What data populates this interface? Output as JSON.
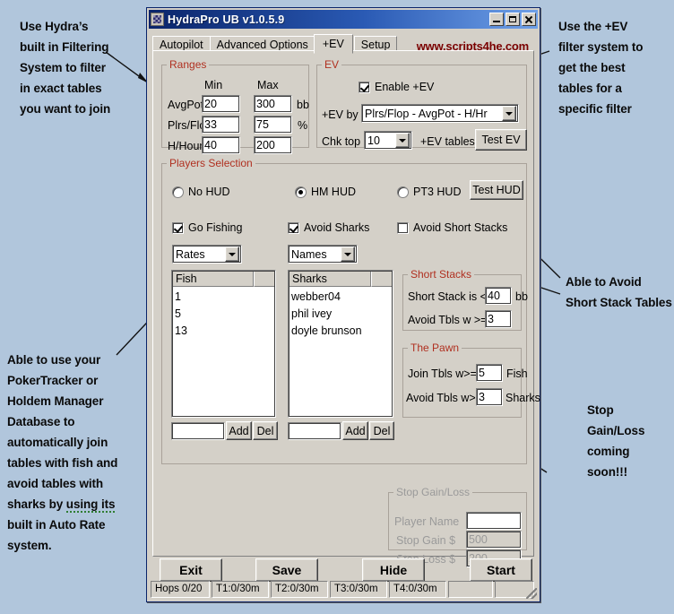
{
  "window": {
    "title": "HydraPro UB v1.0.5.9",
    "icon": "app-icon",
    "minimize": "_",
    "maximize": "□",
    "close": "×"
  },
  "tabs": [
    {
      "label": "Autopilot",
      "selected": false
    },
    {
      "label": "Advanced Options",
      "selected": false
    },
    {
      "label": "+EV",
      "selected": true
    },
    {
      "label": "Setup",
      "selected": false
    }
  ],
  "brand": "www.scripts4he.com",
  "ranges": {
    "legend": "Ranges",
    "col_min": "Min",
    "col_max": "Max",
    "rows": [
      {
        "label": "AvgPot",
        "min": "20",
        "max": "300",
        "unit": "bb"
      },
      {
        "label": "Plrs/Flop",
        "min": "33",
        "max": "75",
        "unit": "%"
      },
      {
        "label": "H/Hour",
        "min": "40",
        "max": "200",
        "unit": ""
      }
    ]
  },
  "ev": {
    "legend": "EV",
    "enable_label": "Enable +EV",
    "enable_checked": true,
    "by_label": "+EV by",
    "by_value": "Plrs/Flop - AvgPot - H/Hr",
    "chk_top_label": "Chk top",
    "chk_top_value": "10",
    "tables_label": "+EV tables",
    "test_button": "Test EV"
  },
  "players_selection": {
    "legend": "Players Selection",
    "radios": [
      {
        "label": "No HUD",
        "selected": false
      },
      {
        "label": "HM HUD",
        "selected": true
      },
      {
        "label": "PT3 HUD",
        "selected": false
      }
    ],
    "test_hud_button": "Test HUD",
    "checkboxes": [
      {
        "label": "Go Fishing",
        "checked": true
      },
      {
        "label": "Avoid Sharks",
        "checked": true
      },
      {
        "label": "Avoid Short Stacks",
        "checked": false
      }
    ],
    "fish_mode": "Rates",
    "sharks_mode": "Names",
    "fish_list": {
      "header": "Fish",
      "items": [
        "1",
        "5",
        "13"
      ],
      "input_value": "",
      "add_button": "Add",
      "del_button": "Del"
    },
    "sharks_list": {
      "header": "Sharks",
      "items": [
        "webber04",
        "phil ivey",
        "doyle brunson"
      ],
      "input_value": "",
      "add_button": "Add",
      "del_button": "Del"
    },
    "short_stacks": {
      "legend": "Short Stacks",
      "stack_label": "Short Stack is <=",
      "stack_value": "40",
      "stack_unit": "bb",
      "avoid_label": "Avoid Tbls w >=",
      "avoid_value": "3"
    },
    "the_pawn": {
      "legend": "The Pawn",
      "join_label": "Join Tbls w>=",
      "join_value": "5",
      "join_unit": "Fish",
      "avoid_label": "Avoid Tbls w>=",
      "avoid_value": "3",
      "avoid_unit": "Sharks"
    }
  },
  "stop_gain_loss": {
    "legend": "Stop Gain/Loss",
    "player_name_label": "Player Name",
    "player_name_value": "",
    "stop_gain_label": "Stop Gain $",
    "stop_gain_value": "500",
    "stop_loss_label": "Stop Loss $",
    "stop_loss_value": "200"
  },
  "footer_buttons": {
    "exit": "Exit",
    "save": "Save",
    "hide": "Hide",
    "start": "Start"
  },
  "statusbar": [
    "Hops 0/20",
    "T1:0/30m",
    "T2:0/30m",
    "T3:0/30m",
    "T4:0/30m",
    "",
    ""
  ],
  "annotations": {
    "top_left": "Use Hydra’s\nbuilt in Filtering\nSystem to filter\nin exact tables\nyou want to join",
    "bottom_left_a": "Able to use your\nPokerTracker or\nHoldem Manager\nDatabase to\nautomatically join\ntables with fish and\navoid tables with\nsharks by ",
    "bottom_left_misspelled": "using its",
    "bottom_left_b": "\nbuilt in Auto Rate\nsystem.",
    "top_right": "Use the +EV\nfilter system to\nget the best\ntables for a\nspecific filter",
    "mid_right": "Able to Avoid\nShort Stack Tables",
    "bottom_right": "Stop\nGain/Loss\ncoming\nsoon!!!"
  },
  "colors": {
    "background": "#b1c6dc",
    "window_face": "#d4d0c8",
    "title_start": "#0a246a",
    "group_legend": "#b03020",
    "brand": "#7a0000"
  }
}
